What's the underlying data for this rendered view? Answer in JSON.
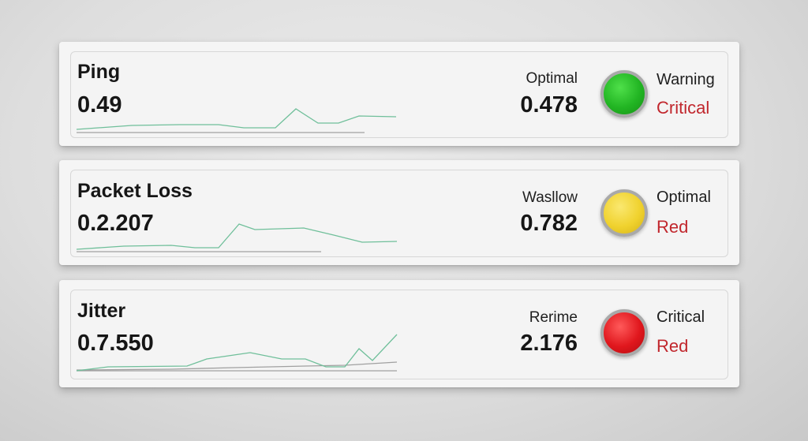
{
  "colors": {
    "sparkline": "#6fbf9a",
    "baseline": "#a0a0a0",
    "critical_text": "#c1272d",
    "light_green": "#22b523",
    "light_yellow": "#f0d22e",
    "light_red": "#e0171d"
  },
  "cards": [
    {
      "title": "Ping",
      "value": "0.49",
      "status_label": "Optimal",
      "status_value": "0.478",
      "light_color": "green",
      "legend_top": "Warning",
      "legend_bottom": "Critical"
    },
    {
      "title": "Packet Loss",
      "value": "0.2.207",
      "status_label": "Wasllow",
      "status_value": "0.782",
      "light_color": "yellow",
      "legend_top": "Optimal",
      "legend_bottom": "Red"
    },
    {
      "title": "Jitter",
      "value": "0.7.550",
      "status_label": "Rerime",
      "status_value": "2.176",
      "light_color": "red",
      "legend_top": "Critical",
      "legend_bottom": "Red"
    }
  ]
}
